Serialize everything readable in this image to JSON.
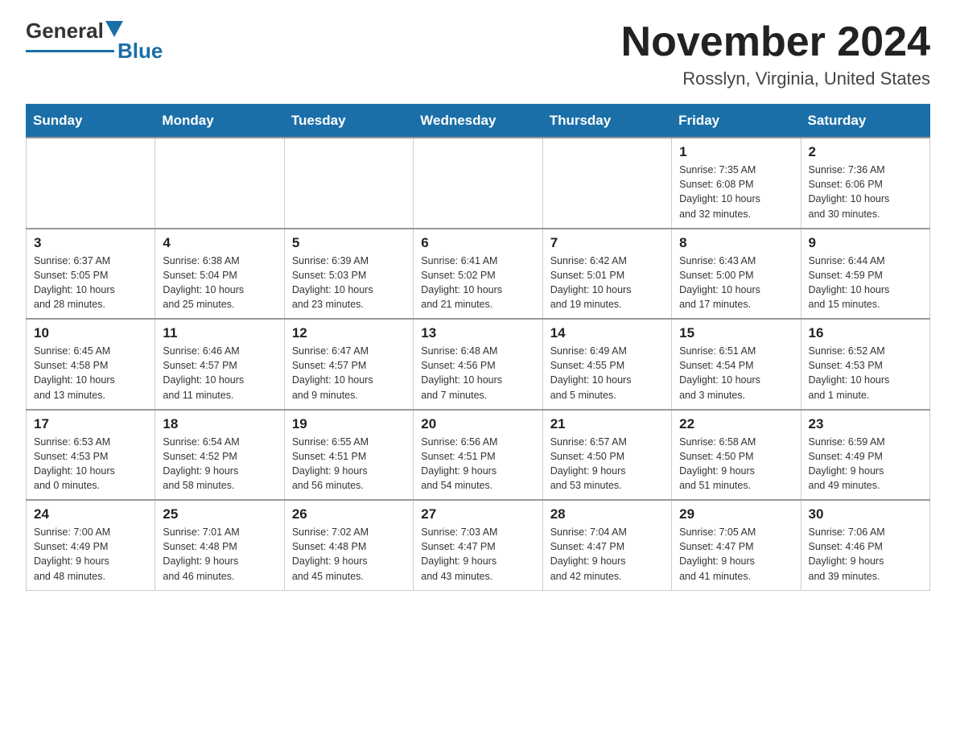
{
  "header": {
    "logo_general": "General",
    "logo_blue": "Blue",
    "title": "November 2024",
    "subtitle": "Rosslyn, Virginia, United States"
  },
  "days_of_week": [
    "Sunday",
    "Monday",
    "Tuesday",
    "Wednesday",
    "Thursday",
    "Friday",
    "Saturday"
  ],
  "weeks": [
    [
      {
        "day": "",
        "info": ""
      },
      {
        "day": "",
        "info": ""
      },
      {
        "day": "",
        "info": ""
      },
      {
        "day": "",
        "info": ""
      },
      {
        "day": "",
        "info": ""
      },
      {
        "day": "1",
        "info": "Sunrise: 7:35 AM\nSunset: 6:08 PM\nDaylight: 10 hours\nand 32 minutes."
      },
      {
        "day": "2",
        "info": "Sunrise: 7:36 AM\nSunset: 6:06 PM\nDaylight: 10 hours\nand 30 minutes."
      }
    ],
    [
      {
        "day": "3",
        "info": "Sunrise: 6:37 AM\nSunset: 5:05 PM\nDaylight: 10 hours\nand 28 minutes."
      },
      {
        "day": "4",
        "info": "Sunrise: 6:38 AM\nSunset: 5:04 PM\nDaylight: 10 hours\nand 25 minutes."
      },
      {
        "day": "5",
        "info": "Sunrise: 6:39 AM\nSunset: 5:03 PM\nDaylight: 10 hours\nand 23 minutes."
      },
      {
        "day": "6",
        "info": "Sunrise: 6:41 AM\nSunset: 5:02 PM\nDaylight: 10 hours\nand 21 minutes."
      },
      {
        "day": "7",
        "info": "Sunrise: 6:42 AM\nSunset: 5:01 PM\nDaylight: 10 hours\nand 19 minutes."
      },
      {
        "day": "8",
        "info": "Sunrise: 6:43 AM\nSunset: 5:00 PM\nDaylight: 10 hours\nand 17 minutes."
      },
      {
        "day": "9",
        "info": "Sunrise: 6:44 AM\nSunset: 4:59 PM\nDaylight: 10 hours\nand 15 minutes."
      }
    ],
    [
      {
        "day": "10",
        "info": "Sunrise: 6:45 AM\nSunset: 4:58 PM\nDaylight: 10 hours\nand 13 minutes."
      },
      {
        "day": "11",
        "info": "Sunrise: 6:46 AM\nSunset: 4:57 PM\nDaylight: 10 hours\nand 11 minutes."
      },
      {
        "day": "12",
        "info": "Sunrise: 6:47 AM\nSunset: 4:57 PM\nDaylight: 10 hours\nand 9 minutes."
      },
      {
        "day": "13",
        "info": "Sunrise: 6:48 AM\nSunset: 4:56 PM\nDaylight: 10 hours\nand 7 minutes."
      },
      {
        "day": "14",
        "info": "Sunrise: 6:49 AM\nSunset: 4:55 PM\nDaylight: 10 hours\nand 5 minutes."
      },
      {
        "day": "15",
        "info": "Sunrise: 6:51 AM\nSunset: 4:54 PM\nDaylight: 10 hours\nand 3 minutes."
      },
      {
        "day": "16",
        "info": "Sunrise: 6:52 AM\nSunset: 4:53 PM\nDaylight: 10 hours\nand 1 minute."
      }
    ],
    [
      {
        "day": "17",
        "info": "Sunrise: 6:53 AM\nSunset: 4:53 PM\nDaylight: 10 hours\nand 0 minutes."
      },
      {
        "day": "18",
        "info": "Sunrise: 6:54 AM\nSunset: 4:52 PM\nDaylight: 9 hours\nand 58 minutes."
      },
      {
        "day": "19",
        "info": "Sunrise: 6:55 AM\nSunset: 4:51 PM\nDaylight: 9 hours\nand 56 minutes."
      },
      {
        "day": "20",
        "info": "Sunrise: 6:56 AM\nSunset: 4:51 PM\nDaylight: 9 hours\nand 54 minutes."
      },
      {
        "day": "21",
        "info": "Sunrise: 6:57 AM\nSunset: 4:50 PM\nDaylight: 9 hours\nand 53 minutes."
      },
      {
        "day": "22",
        "info": "Sunrise: 6:58 AM\nSunset: 4:50 PM\nDaylight: 9 hours\nand 51 minutes."
      },
      {
        "day": "23",
        "info": "Sunrise: 6:59 AM\nSunset: 4:49 PM\nDaylight: 9 hours\nand 49 minutes."
      }
    ],
    [
      {
        "day": "24",
        "info": "Sunrise: 7:00 AM\nSunset: 4:49 PM\nDaylight: 9 hours\nand 48 minutes."
      },
      {
        "day": "25",
        "info": "Sunrise: 7:01 AM\nSunset: 4:48 PM\nDaylight: 9 hours\nand 46 minutes."
      },
      {
        "day": "26",
        "info": "Sunrise: 7:02 AM\nSunset: 4:48 PM\nDaylight: 9 hours\nand 45 minutes."
      },
      {
        "day": "27",
        "info": "Sunrise: 7:03 AM\nSunset: 4:47 PM\nDaylight: 9 hours\nand 43 minutes."
      },
      {
        "day": "28",
        "info": "Sunrise: 7:04 AM\nSunset: 4:47 PM\nDaylight: 9 hours\nand 42 minutes."
      },
      {
        "day": "29",
        "info": "Sunrise: 7:05 AM\nSunset: 4:47 PM\nDaylight: 9 hours\nand 41 minutes."
      },
      {
        "day": "30",
        "info": "Sunrise: 7:06 AM\nSunset: 4:46 PM\nDaylight: 9 hours\nand 39 minutes."
      }
    ]
  ]
}
